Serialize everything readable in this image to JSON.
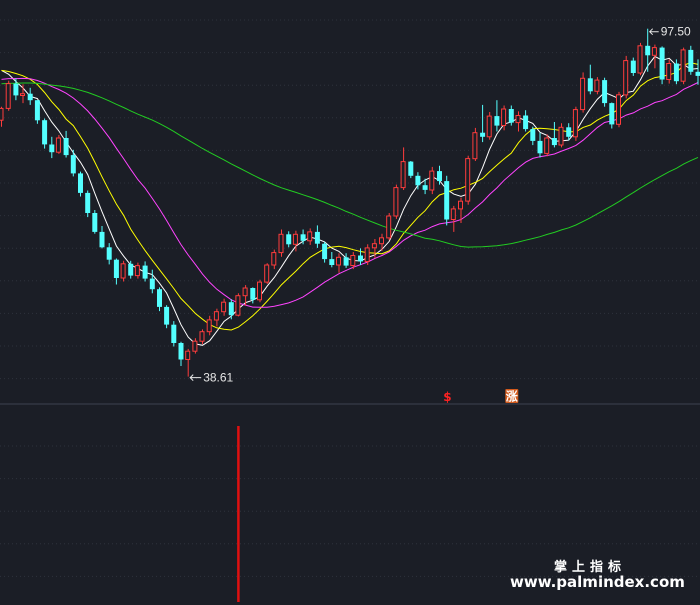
{
  "chart_data": {
    "type": "candlestick",
    "price_high_label": "97.50",
    "price_low_label": "38.61",
    "y_range": [
      36,
      101
    ],
    "candles": [
      [
        82.0,
        84.3,
        80.9,
        84.0
      ],
      [
        84.0,
        88.7,
        83.6,
        88.2
      ],
      [
        88.2,
        89.1,
        85.4,
        86.2
      ],
      [
        86.2,
        88.1,
        84.9,
        86.5
      ],
      [
        86.5,
        87.5,
        84.6,
        85.4
      ],
      [
        85.4,
        85.4,
        81.4,
        82.0
      ],
      [
        82.0,
        82.3,
        77.2,
        77.9
      ],
      [
        77.9,
        79.2,
        75.6,
        76.6
      ],
      [
        76.6,
        79.5,
        76.3,
        79.0
      ],
      [
        79.0,
        80.2,
        75.7,
        76.1
      ],
      [
        76.1,
        77.0,
        72.5,
        73.0
      ],
      [
        73.0,
        73.3,
        69.1,
        69.7
      ],
      [
        69.7,
        70.1,
        65.6,
        66.3
      ],
      [
        66.3,
        66.8,
        62.8,
        63.1
      ],
      [
        63.1,
        64.1,
        60.3,
        60.5
      ],
      [
        60.5,
        61.2,
        57.6,
        58.4
      ],
      [
        58.4,
        58.6,
        54.2,
        55.3
      ],
      [
        55.3,
        58.2,
        54.7,
        57.7
      ],
      [
        57.7,
        58.2,
        55.2,
        55.7
      ],
      [
        55.7,
        57.9,
        55.2,
        57.4
      ],
      [
        57.4,
        58.1,
        54.7,
        55.2
      ],
      [
        55.2,
        56.7,
        52.7,
        53.4
      ],
      [
        53.4,
        53.7,
        49.7,
        50.4
      ],
      [
        50.4,
        50.7,
        46.8,
        47.4
      ],
      [
        47.4,
        48.0,
        43.7,
        44.3
      ],
      [
        44.3,
        44.5,
        40.4,
        41.5
      ],
      [
        41.5,
        43.3,
        38.6,
        42.9
      ],
      [
        42.9,
        45.1,
        42.5,
        44.6
      ],
      [
        44.6,
        46.6,
        44.1,
        46.2
      ],
      [
        46.2,
        48.9,
        45.6,
        48.2
      ],
      [
        48.2,
        50.1,
        47.1,
        49.6
      ],
      [
        49.6,
        51.8,
        48.9,
        51.2
      ],
      [
        51.2,
        51.7,
        48.3,
        49.0
      ],
      [
        49.0,
        52.7,
        48.8,
        52.3
      ],
      [
        52.3,
        54.1,
        50.6,
        53.6
      ],
      [
        53.6,
        53.7,
        51.0,
        51.6
      ],
      [
        51.6,
        55.0,
        51.2,
        54.6
      ],
      [
        54.6,
        57.8,
        54.3,
        57.5
      ],
      [
        57.5,
        60.1,
        56.8,
        59.6
      ],
      [
        59.6,
        63.5,
        58.9,
        62.7
      ],
      [
        62.7,
        63.2,
        60.5,
        61.0
      ],
      [
        61.0,
        63.3,
        59.8,
        62.7
      ],
      [
        62.7,
        63.5,
        61.0,
        61.6
      ],
      [
        61.6,
        63.7,
        60.9,
        63.1
      ],
      [
        63.1,
        64.2,
        60.4,
        61.1
      ],
      [
        61.1,
        61.4,
        57.9,
        58.5
      ],
      [
        58.5,
        59.7,
        57.1,
        57.5
      ],
      [
        57.5,
        59.5,
        56.2,
        58.8
      ],
      [
        58.8,
        59.5,
        57.0,
        57.4
      ],
      [
        57.4,
        59.7,
        56.8,
        59.1
      ],
      [
        59.1,
        60.3,
        57.5,
        58.1
      ],
      [
        58.1,
        61.0,
        57.5,
        60.4
      ],
      [
        60.4,
        61.9,
        58.7,
        61.1
      ],
      [
        61.1,
        62.8,
        59.9,
        62.1
      ],
      [
        62.1,
        66.3,
        61.7,
        65.8
      ],
      [
        65.8,
        71.1,
        65.3,
        70.6
      ],
      [
        70.6,
        77.4,
        70.2,
        75.0
      ],
      [
        75.0,
        75.1,
        72.2,
        72.6
      ],
      [
        72.6,
        73.2,
        70.3,
        71.0
      ],
      [
        71.0,
        72.1,
        69.5,
        70.2
      ],
      [
        70.2,
        74.1,
        69.5,
        73.4
      ],
      [
        73.4,
        74.3,
        71.1,
        71.7
      ],
      [
        71.7,
        72.6,
        64.2,
        65.2
      ],
      [
        65.2,
        67.5,
        63.1,
        67.0
      ],
      [
        67.0,
        68.9,
        64.6,
        68.3
      ],
      [
        68.3,
        76.0,
        67.7,
        75.5
      ],
      [
        75.5,
        80.7,
        75.1,
        79.9
      ],
      [
        79.9,
        84.6,
        78.3,
        79.2
      ],
      [
        79.2,
        83.4,
        78.7,
        82.7
      ],
      [
        82.7,
        85.4,
        80.1,
        81.1
      ],
      [
        81.1,
        84.5,
        80.3,
        83.9
      ],
      [
        83.9,
        84.5,
        81.1,
        81.6
      ],
      [
        81.6,
        83.5,
        80.1,
        82.8
      ],
      [
        82.8,
        83.7,
        80.1,
        80.5
      ],
      [
        80.5,
        80.9,
        77.8,
        78.5
      ],
      [
        78.5,
        79.9,
        75.7,
        76.4
      ],
      [
        76.4,
        79.6,
        75.9,
        79.0
      ],
      [
        79.0,
        81.7,
        77.4,
        77.8
      ],
      [
        77.8,
        81.5,
        77.4,
        80.8
      ],
      [
        80.8,
        81.5,
        78.6,
        79.2
      ],
      [
        79.2,
        84.3,
        78.5,
        83.8
      ],
      [
        83.8,
        90.1,
        83.3,
        89.1
      ],
      [
        89.1,
        91.4,
        86.4,
        86.9
      ],
      [
        86.9,
        89.3,
        86.4,
        88.8
      ],
      [
        88.8,
        89.2,
        84.3,
        84.9
      ],
      [
        84.9,
        85.0,
        80.6,
        81.3
      ],
      [
        81.3,
        86.8,
        80.8,
        86.3
      ],
      [
        86.3,
        92.9,
        85.7,
        92.1
      ],
      [
        92.1,
        92.6,
        89.5,
        90.0
      ],
      [
        90.0,
        95.1,
        89.6,
        94.6
      ],
      [
        94.6,
        97.5,
        90.2,
        93.0
      ],
      [
        93.0,
        94.8,
        90.8,
        94.3
      ],
      [
        94.3,
        94.5,
        88.1,
        88.9
      ],
      [
        88.9,
        92.3,
        88.2,
        91.6
      ],
      [
        91.6,
        92.3,
        88.1,
        88.6
      ],
      [
        88.6,
        94.3,
        88.1,
        93.9
      ],
      [
        93.9,
        94.6,
        89.7,
        90.2
      ],
      [
        90.2,
        92.3,
        88.0,
        89.5
      ]
    ],
    "moving_averages": [
      {
        "period": 5,
        "color": "#ffffff"
      },
      {
        "period": 10,
        "color": "#ffff00"
      },
      {
        "period": 20,
        "color": "#ff44ff"
      },
      {
        "period": 60,
        "color": "#22cc22"
      }
    ],
    "signals": [
      {
        "index": 62,
        "glyph": "$",
        "color": "#ff2222",
        "kind": "text"
      },
      {
        "index": 71,
        "glyph": "涨",
        "color": "#ffffff",
        "kind": "badge",
        "badge_color": "#d25a1c"
      }
    ],
    "indicator_bars": [
      {
        "index": 33,
        "value": 1
      }
    ],
    "up_color": "#ff3c3c",
    "down_color": "#54ffff",
    "indicator_color": "#e01010"
  },
  "watermark": {
    "line1": "掌上指标",
    "line2": "www.palmindex.com"
  }
}
